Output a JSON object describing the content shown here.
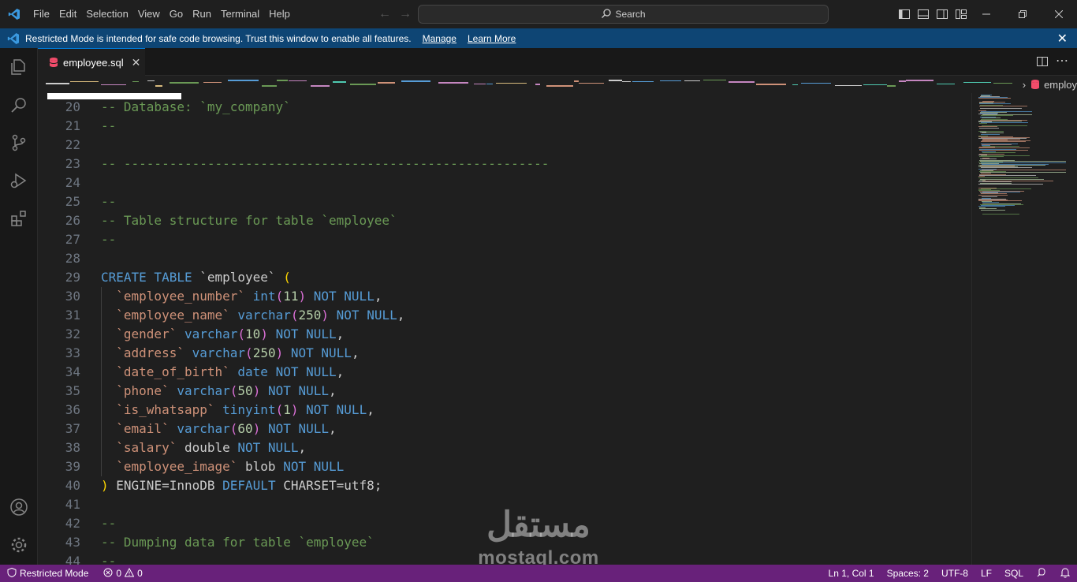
{
  "menu": [
    "File",
    "Edit",
    "Selection",
    "View",
    "Go",
    "Run",
    "Terminal",
    "Help"
  ],
  "search": {
    "label": "Search"
  },
  "banner": {
    "text": "Restricted Mode is intended for safe code browsing. Trust this window to enable all features.",
    "manage": "Manage",
    "learn_more": "Learn More"
  },
  "tab": {
    "filename": "employee.sql"
  },
  "breadcrumb": {
    "file": "employ"
  },
  "editor": {
    "lines": [
      {
        "n": "20",
        "parts": [
          {
            "t": "-- Database: `my_company`",
            "c": "c-cmt"
          }
        ]
      },
      {
        "n": "21",
        "parts": [
          {
            "t": "--",
            "c": "c-cmt"
          }
        ]
      },
      {
        "n": "22",
        "parts": []
      },
      {
        "n": "23",
        "parts": [
          {
            "t": "-- --------------------------------------------------------",
            "c": "c-cmt"
          }
        ]
      },
      {
        "n": "24",
        "parts": []
      },
      {
        "n": "25",
        "parts": [
          {
            "t": "--",
            "c": "c-cmt"
          }
        ]
      },
      {
        "n": "26",
        "parts": [
          {
            "t": "-- Table structure for table `employee`",
            "c": "c-cmt"
          }
        ]
      },
      {
        "n": "27",
        "parts": [
          {
            "t": "--",
            "c": "c-cmt"
          }
        ]
      },
      {
        "n": "28",
        "parts": []
      },
      {
        "n": "29",
        "parts": [
          {
            "t": "CREATE TABLE ",
            "c": "c-kw"
          },
          {
            "t": "`employee`",
            "c": "c-plain"
          },
          {
            "t": " ",
            "c": "c-plain"
          },
          {
            "t": "(",
            "c": "c-br1"
          }
        ]
      },
      {
        "n": "30",
        "parts": [
          {
            "t": "  `employee_number`",
            "c": "c-str"
          },
          {
            "t": " ",
            "c": "c-plain"
          },
          {
            "t": "int",
            "c": "c-kw"
          },
          {
            "t": "(",
            "c": "c-br2"
          },
          {
            "t": "11",
            "c": "c-num"
          },
          {
            "t": ")",
            "c": "c-br2"
          },
          {
            "t": " NOT NULL",
            "c": "c-kw"
          },
          {
            "t": ",",
            "c": "c-plain"
          }
        ]
      },
      {
        "n": "31",
        "parts": [
          {
            "t": "  `employee_name`",
            "c": "c-str"
          },
          {
            "t": " ",
            "c": "c-plain"
          },
          {
            "t": "varchar",
            "c": "c-kw"
          },
          {
            "t": "(",
            "c": "c-br2"
          },
          {
            "t": "250",
            "c": "c-num"
          },
          {
            "t": ")",
            "c": "c-br2"
          },
          {
            "t": " NOT NULL",
            "c": "c-kw"
          },
          {
            "t": ",",
            "c": "c-plain"
          }
        ]
      },
      {
        "n": "32",
        "parts": [
          {
            "t": "  `gender`",
            "c": "c-str"
          },
          {
            "t": " ",
            "c": "c-plain"
          },
          {
            "t": "varchar",
            "c": "c-kw"
          },
          {
            "t": "(",
            "c": "c-br2"
          },
          {
            "t": "10",
            "c": "c-num"
          },
          {
            "t": ")",
            "c": "c-br2"
          },
          {
            "t": " NOT NULL",
            "c": "c-kw"
          },
          {
            "t": ",",
            "c": "c-plain"
          }
        ]
      },
      {
        "n": "33",
        "parts": [
          {
            "t": "  `address`",
            "c": "c-str"
          },
          {
            "t": " ",
            "c": "c-plain"
          },
          {
            "t": "varchar",
            "c": "c-kw"
          },
          {
            "t": "(",
            "c": "c-br2"
          },
          {
            "t": "250",
            "c": "c-num"
          },
          {
            "t": ")",
            "c": "c-br2"
          },
          {
            "t": " NOT NULL",
            "c": "c-kw"
          },
          {
            "t": ",",
            "c": "c-plain"
          }
        ]
      },
      {
        "n": "34",
        "parts": [
          {
            "t": "  `date_of_birth`",
            "c": "c-str"
          },
          {
            "t": " ",
            "c": "c-plain"
          },
          {
            "t": "date NOT NULL",
            "c": "c-kw"
          },
          {
            "t": ",",
            "c": "c-plain"
          }
        ]
      },
      {
        "n": "35",
        "parts": [
          {
            "t": "  `phone`",
            "c": "c-str"
          },
          {
            "t": " ",
            "c": "c-plain"
          },
          {
            "t": "varchar",
            "c": "c-kw"
          },
          {
            "t": "(",
            "c": "c-br2"
          },
          {
            "t": "50",
            "c": "c-num"
          },
          {
            "t": ")",
            "c": "c-br2"
          },
          {
            "t": " NOT NULL",
            "c": "c-kw"
          },
          {
            "t": ",",
            "c": "c-plain"
          }
        ]
      },
      {
        "n": "36",
        "parts": [
          {
            "t": "  `is_whatsapp`",
            "c": "c-str"
          },
          {
            "t": " ",
            "c": "c-plain"
          },
          {
            "t": "tinyint",
            "c": "c-kw"
          },
          {
            "t": "(",
            "c": "c-br2"
          },
          {
            "t": "1",
            "c": "c-num"
          },
          {
            "t": ")",
            "c": "c-br2"
          },
          {
            "t": " NOT NULL",
            "c": "c-kw"
          },
          {
            "t": ",",
            "c": "c-plain"
          }
        ]
      },
      {
        "n": "37",
        "parts": [
          {
            "t": "  `email`",
            "c": "c-str"
          },
          {
            "t": " ",
            "c": "c-plain"
          },
          {
            "t": "varchar",
            "c": "c-kw"
          },
          {
            "t": "(",
            "c": "c-br2"
          },
          {
            "t": "60",
            "c": "c-num"
          },
          {
            "t": ")",
            "c": "c-br2"
          },
          {
            "t": " NOT NULL",
            "c": "c-kw"
          },
          {
            "t": ",",
            "c": "c-plain"
          }
        ]
      },
      {
        "n": "38",
        "parts": [
          {
            "t": "  `salary`",
            "c": "c-str"
          },
          {
            "t": " double ",
            "c": "c-plain"
          },
          {
            "t": "NOT NULL",
            "c": "c-kw"
          },
          {
            "t": ",",
            "c": "c-plain"
          }
        ]
      },
      {
        "n": "39",
        "parts": [
          {
            "t": "  `employee_image`",
            "c": "c-str"
          },
          {
            "t": " blob ",
            "c": "c-plain"
          },
          {
            "t": "NOT NULL",
            "c": "c-kw"
          }
        ]
      },
      {
        "n": "40",
        "parts": [
          {
            "t": ")",
            "c": "c-br1"
          },
          {
            "t": " ENGINE=InnoDB ",
            "c": "c-plain"
          },
          {
            "t": "DEFAULT",
            "c": "c-kw"
          },
          {
            "t": " CHARSET=utf8;",
            "c": "c-plain"
          }
        ]
      },
      {
        "n": "41",
        "parts": []
      },
      {
        "n": "42",
        "parts": [
          {
            "t": "--",
            "c": "c-cmt"
          }
        ]
      },
      {
        "n": "43",
        "parts": [
          {
            "t": "-- Dumping data for table `employee`",
            "c": "c-cmt"
          }
        ]
      },
      {
        "n": "44",
        "parts": [
          {
            "t": "--",
            "c": "c-cmt"
          }
        ]
      }
    ]
  },
  "watermark": {
    "arabic": "مستقل",
    "latin": "mostaql.com"
  },
  "status": {
    "restricted": "Restricted Mode",
    "errors": "0",
    "warnings": "0",
    "position": "Ln 1, Col 1",
    "spaces": "Spaces: 2",
    "encoding": "UTF-8",
    "eol": "LF",
    "language": "SQL"
  },
  "colors": {
    "accent": "#0078d4",
    "status_bar": "#68217a",
    "banner": "#0e4574",
    "comment": "#6a9955",
    "keyword": "#569cd6",
    "string": "#ce9178",
    "number": "#b5cea8"
  }
}
